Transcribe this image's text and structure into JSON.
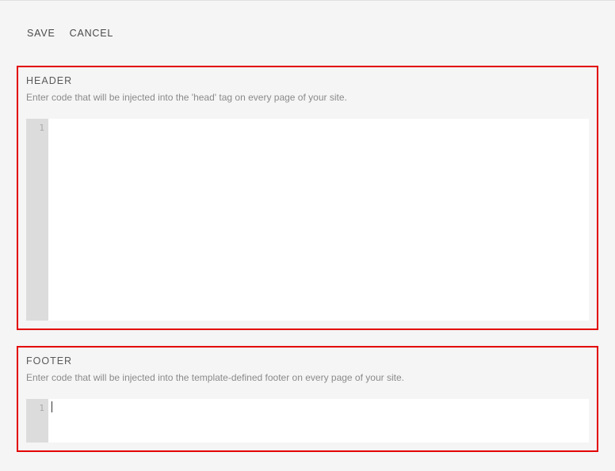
{
  "toolbar": {
    "save_label": "SAVE",
    "cancel_label": "CANCEL"
  },
  "sections": {
    "header": {
      "title": "HEADER",
      "description": "Enter code that will be injected into the 'head' tag on every page of your site.",
      "line_number": "1",
      "value": ""
    },
    "footer": {
      "title": "FOOTER",
      "description": "Enter code that will be injected into the template-defined footer on every page of your site.",
      "line_number": "1",
      "value": ""
    }
  }
}
